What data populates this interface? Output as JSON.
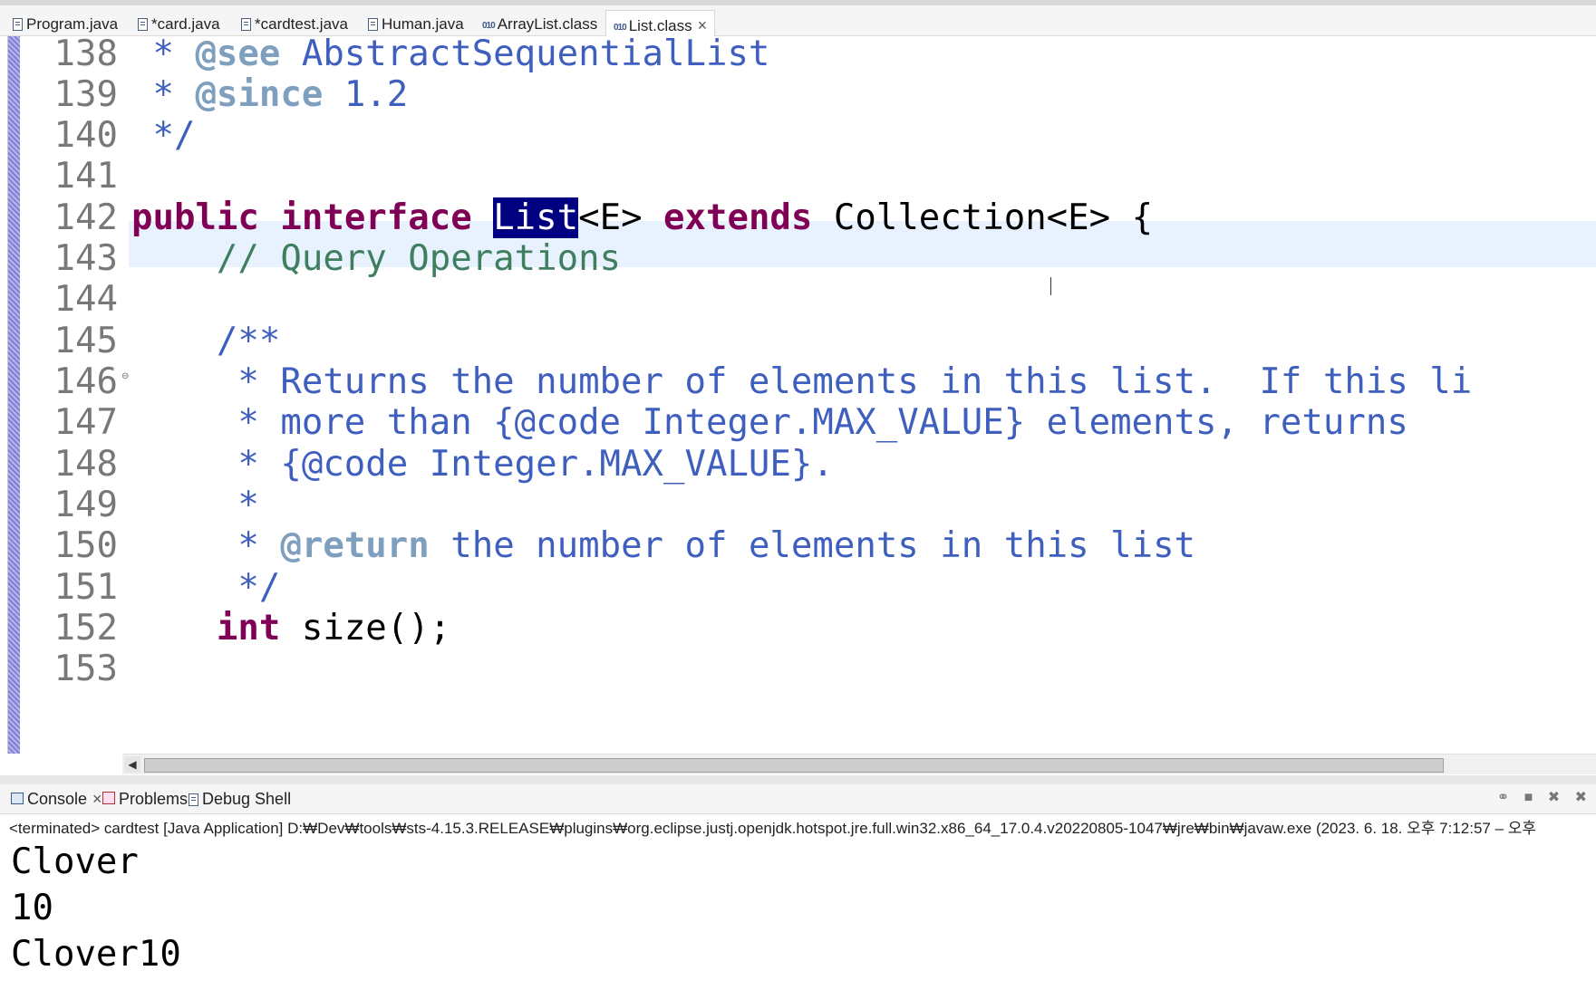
{
  "tabs": [
    {
      "label": "Program.java",
      "icon": "java-file-icon"
    },
    {
      "label": "*card.java",
      "icon": "java-file-icon"
    },
    {
      "label": "*cardtest.java",
      "icon": "java-file-icon"
    },
    {
      "label": "Human.java",
      "icon": "java-file-icon"
    },
    {
      "label": "ArrayList.class",
      "icon": "class-file-icon"
    },
    {
      "label": "List.class",
      "icon": "class-file-icon",
      "active": true
    }
  ],
  "class_icon_text": "010",
  "tab_close_glyph": "×",
  "editor": {
    "line_numbers": [
      "138",
      "139",
      "140",
      "141",
      "142",
      "143",
      "144",
      "145",
      "146",
      "147",
      "148",
      "149",
      "150",
      "151",
      "152",
      "153"
    ],
    "lines": {
      "l138": {
        "star": " * ",
        "tag": "@see",
        "rest": " AbstractSequentialList"
      },
      "l139": {
        "star": " * ",
        "tag": "@since",
        "rest": " 1.2"
      },
      "l140": {
        "text": " */"
      },
      "l142": {
        "kw1": "public",
        "kw2": "interface",
        "selected": "List",
        "generic": "<E> ",
        "kw3": "extends",
        "rest": " Collection<E> {"
      },
      "l143": {
        "text": "    // Query Operations"
      },
      "l145": {
        "text": "    /**"
      },
      "l146": {
        "text": "     * Returns the number of elements in this list.  If this li"
      },
      "l147": {
        "text": "     * more than {@code Integer.MAX_VALUE} elements, returns"
      },
      "l148": {
        "text": "     * {@code Integer.MAX_VALUE}."
      },
      "l149": {
        "text": "     *"
      },
      "l150": {
        "star": "     * ",
        "tag": "@return",
        "rest": " the number of elements in this list"
      },
      "l151": {
        "text": "     */"
      },
      "l152": {
        "indent": "    ",
        "kw": "int",
        "rest": " size();"
      }
    }
  },
  "console": {
    "tabs": [
      {
        "label": "Console",
        "close": "×"
      },
      {
        "label": "Problems"
      },
      {
        "label": "Debug Shell"
      }
    ],
    "toolbar_glyphs": "⚭ ■ ✖ ✖",
    "status": "<terminated> cardtest [Java Application] D:₩Dev₩tools₩sts-4.15.3.RELEASE₩plugins₩org.eclipse.justj.openjdk.hotspot.jre.full.win32.x86_64_17.0.4.v20220805-1047₩jre₩bin₩javaw.exe  (2023. 6. 18. 오후 7:12:57 – 오후",
    "output": [
      "Clover",
      "10",
      "Clover10"
    ]
  },
  "colors": {
    "keyword": "#7f0055",
    "javadoc": "#3f5fbf",
    "javadoc_tag": "#7f9fbf",
    "comment": "#3f7f5f",
    "selection": "#000080",
    "current_line": "#e8f2fe"
  }
}
